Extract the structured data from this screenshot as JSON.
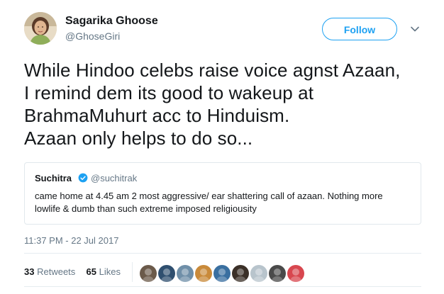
{
  "author": {
    "name": "Sagarika Ghoose",
    "handle": "@GhoseGiri",
    "avatar_icon": "profile-photo-icon"
  },
  "follow_label": "Follow",
  "tweet": {
    "lines": [
      "While Hindoo celebs raise voice agnst Azaan,",
      "I remind dem its good to wakeup at",
      "BrahmaMuhurt acc to Hinduism.",
      "Azaan only helps to do so..."
    ]
  },
  "quote": {
    "name": "Suchitra",
    "handle": "@suchitrak",
    "verified_icon": "verified-badge-icon",
    "lines": [
      "came home at 4.45 am 2 most aggressive/ ear shattering call of azaan. Nothing more",
      "lowlife & dumb than such extreme imposed religiousity"
    ]
  },
  "timestamp": "11:37 PM - 22 Jul 2017",
  "stats": {
    "retweets_count": "33",
    "retweets_label": "Retweets",
    "likes_count": "65",
    "likes_label": "Likes"
  },
  "likers": [
    {
      "icon": "liker-avatar-icon",
      "color": "#6b5a4a"
    },
    {
      "icon": "liker-avatar-icon",
      "color": "#2f4f6f"
    },
    {
      "icon": "liker-avatar-icon",
      "color": "#6f8fa8"
    },
    {
      "icon": "liker-avatar-icon",
      "color": "#c98a3a"
    },
    {
      "icon": "liker-avatar-icon",
      "color": "#3a6fa0"
    },
    {
      "icon": "liker-avatar-icon",
      "color": "#3b3028"
    },
    {
      "icon": "liker-avatar-icon",
      "color": "#b8c4cc"
    },
    {
      "icon": "liker-avatar-icon",
      "color": "#4a4a4a"
    },
    {
      "icon": "liker-avatar-icon",
      "color": "#d8474f"
    }
  ],
  "colors": {
    "accent": "#1da1f2",
    "text": "#14171a",
    "muted": "#657786",
    "border": "#e1e8ed"
  }
}
